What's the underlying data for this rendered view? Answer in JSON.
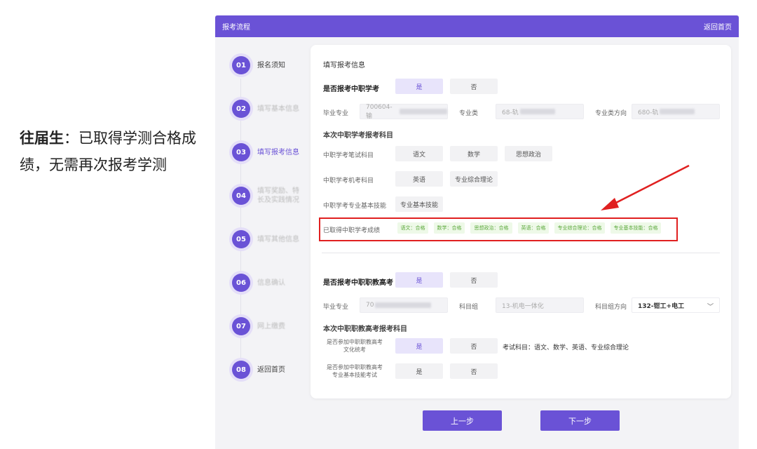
{
  "caption": {
    "bold": "往届生",
    "rest": "：已取得学测合格成绩，无需再次报考学测"
  },
  "header": {
    "title": "报考流程",
    "home_link": "返回首页"
  },
  "steps": [
    {
      "num": "01",
      "label": "报名须知"
    },
    {
      "num": "02",
      "label": "填写基本信息"
    },
    {
      "num": "03",
      "label": "填写报考信息"
    },
    {
      "num": "04",
      "label": "填写奖励、特长及实践情况"
    },
    {
      "num": "05",
      "label": "填写其他信息"
    },
    {
      "num": "06",
      "label": "信息确认"
    },
    {
      "num": "07",
      "label": "网上缴费"
    },
    {
      "num": "08",
      "label": "返回首页"
    }
  ],
  "form": {
    "section_title": "填写报考信息",
    "xueke": {
      "question": "是否报考中职学考",
      "yes": "是",
      "no": "否",
      "major_label": "毕业专业",
      "major_value": "700604-输",
      "category_label": "专业类",
      "category_value": "68-轨",
      "direction_label": "专业类方向",
      "direction_value": "680-轨"
    },
    "subjects_title": "本次中职学考报考科目",
    "written": {
      "label": "中职学考笔试科目",
      "items": [
        "语文",
        "数学",
        "思想政治"
      ]
    },
    "computer": {
      "label": "中职学考机考科目",
      "items": [
        "英语",
        "专业综合理论"
      ]
    },
    "skill": {
      "label": "中职学考专业基本技能",
      "items": [
        "专业基本技能"
      ]
    },
    "scores": {
      "label": "已取得中职学考成绩",
      "items": [
        "语文：合格",
        "数学：合格",
        "思想政治：合格",
        "英语：合格",
        "专业综合理论：合格",
        "专业基本技能：合格"
      ]
    },
    "gaokao": {
      "question": "是否报考中职职教高考",
      "yes": "是",
      "no": "否",
      "major_label": "毕业专业",
      "major_value": "70",
      "group_label": "科目组",
      "group_value": "13-机电一体化",
      "group_dir_label": "科目组方向",
      "group_dir_value": "132-钳工+电工",
      "subjects_title": "本次中职职教高考报考科目",
      "culture_label_1": "是否参加中职职教高考",
      "culture_label_2": "文化统考",
      "culture_yes": "是",
      "culture_no": "否",
      "culture_note": "考试科目：语文、数学、英语、专业综合理论",
      "skill_label_1": "是否参加中职职教高考",
      "skill_label_2": "专业基本技能考试",
      "skill_yes": "是",
      "skill_no": "否"
    }
  },
  "nav": {
    "prev": "上一步",
    "next": "下一步"
  },
  "colors": {
    "accent": "#6a52d6",
    "highlight_box": "#e02020",
    "pass_tag": "#5aa83a"
  }
}
